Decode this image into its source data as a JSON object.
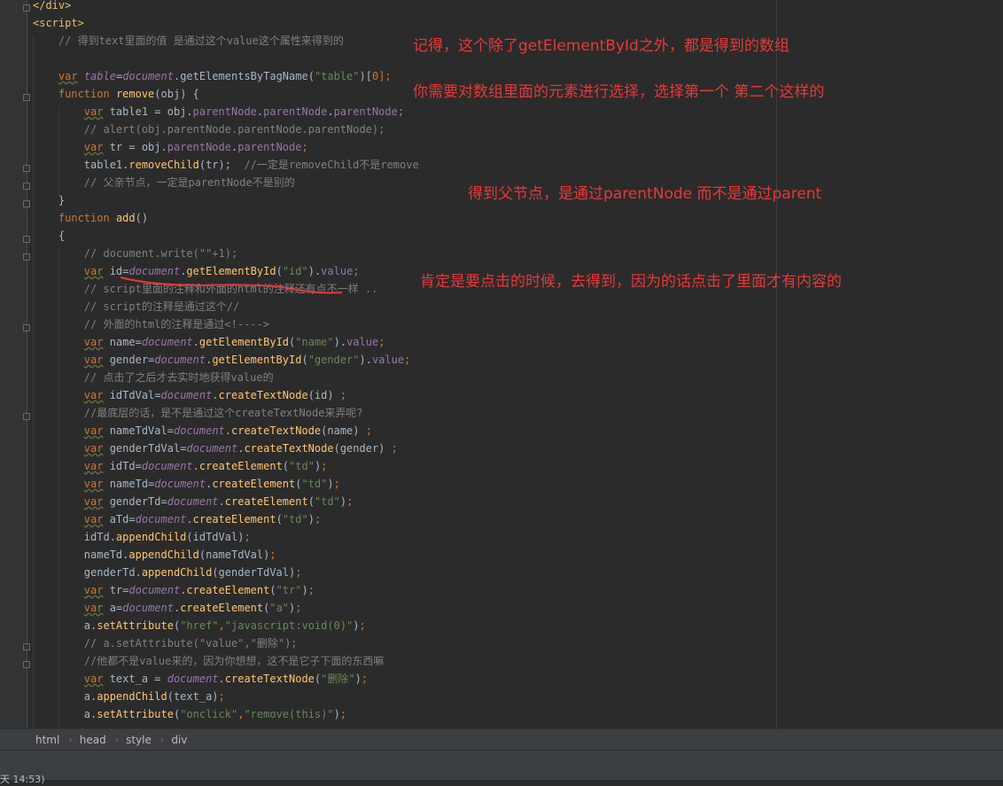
{
  "colors": {
    "background": "#2b2b2b",
    "tag": "#e8bf6a",
    "comment": "#808080",
    "keyword": "#cc7832",
    "string": "#6a8759",
    "method": "#ffc66d",
    "global": "#9876aa",
    "property": "#9876aa",
    "plain": "#a9b7c6",
    "annotation": "#e8383a"
  },
  "code_lines": [
    [
      {
        "t": "</div>",
        "c": "tag"
      }
    ],
    [
      {
        "t": "<script>",
        "c": "tag"
      }
    ],
    [
      {
        "t": "    ",
        "c": "plain"
      },
      {
        "t": "// 得到text里面的值 是通过这个value这个属性来得到的",
        "c": "comment"
      }
    ],
    [
      {
        "t": "",
        "c": "plain"
      }
    ],
    [
      {
        "t": "    ",
        "c": "plain"
      },
      {
        "t": "var",
        "c": "keyword"
      },
      {
        "t": " ",
        "c": "plain"
      },
      {
        "t": "table",
        "c": "global"
      },
      {
        "t": "=",
        "c": "plain"
      },
      {
        "t": "document",
        "c": "global"
      },
      {
        "t": ".getElementsByTagName(",
        "c": "plain"
      },
      {
        "t": "\"table\"",
        "c": "string"
      },
      {
        "t": ")[",
        "c": "plain"
      },
      {
        "t": "0",
        "c": "keyword"
      },
      {
        "t": "];",
        "c": "keyword"
      }
    ],
    [
      {
        "t": "    ",
        "c": "plain"
      },
      {
        "t": "function",
        "c": "keyword"
      },
      {
        "t": " ",
        "c": "plain"
      },
      {
        "t": "remove",
        "c": "method"
      },
      {
        "t": "(obj) {",
        "c": "plain"
      }
    ],
    [
      {
        "t": "        ",
        "c": "plain"
      },
      {
        "t": "var",
        "c": "keyword"
      },
      {
        "t": " table1 = obj.",
        "c": "plain"
      },
      {
        "t": "parentNode",
        "c": "property"
      },
      {
        "t": ".",
        "c": "plain"
      },
      {
        "t": "parentNode",
        "c": "property"
      },
      {
        "t": ".",
        "c": "plain"
      },
      {
        "t": "parentNode",
        "c": "property"
      },
      {
        "t": ";",
        "c": "keyword"
      }
    ],
    [
      {
        "t": "        ",
        "c": "plain"
      },
      {
        "t": "// alert(obj.parentNode.parentNode.parentNode);",
        "c": "comment"
      }
    ],
    [
      {
        "t": "        ",
        "c": "plain"
      },
      {
        "t": "var",
        "c": "keyword"
      },
      {
        "t": " tr = obj.",
        "c": "plain"
      },
      {
        "t": "parentNode",
        "c": "property"
      },
      {
        "t": ".",
        "c": "plain"
      },
      {
        "t": "parentNode",
        "c": "property"
      },
      {
        "t": ";",
        "c": "keyword"
      }
    ],
    [
      {
        "t": "        table1.",
        "c": "plain"
      },
      {
        "t": "removeChild",
        "c": "method"
      },
      {
        "t": "(tr);  ",
        "c": "plain"
      },
      {
        "t": "//一定是removeChild不是remove",
        "c": "comment"
      }
    ],
    [
      {
        "t": "        ",
        "c": "plain"
      },
      {
        "t": "// 父亲节点，一定是parentNode不是别的",
        "c": "comment"
      }
    ],
    [
      {
        "t": "    }",
        "c": "plain"
      }
    ],
    [
      {
        "t": "    ",
        "c": "plain"
      },
      {
        "t": "function",
        "c": "keyword"
      },
      {
        "t": " ",
        "c": "plain"
      },
      {
        "t": "add",
        "c": "method"
      },
      {
        "t": "()",
        "c": "plain"
      }
    ],
    [
      {
        "t": "    {",
        "c": "plain"
      }
    ],
    [
      {
        "t": "        ",
        "c": "plain"
      },
      {
        "t": "// document.write(\"\"+1);",
        "c": "comment"
      }
    ],
    [
      {
        "t": "        ",
        "c": "plain"
      },
      {
        "t": "var",
        "c": "keyword"
      },
      {
        "t": " id=",
        "c": "plain"
      },
      {
        "t": "document",
        "c": "global"
      },
      {
        "t": ".",
        "c": "plain"
      },
      {
        "t": "getElementById",
        "c": "method"
      },
      {
        "t": "(",
        "c": "plain"
      },
      {
        "t": "\"id\"",
        "c": "string"
      },
      {
        "t": ").",
        "c": "plain"
      },
      {
        "t": "value",
        "c": "property"
      },
      {
        "t": ";",
        "c": "keyword"
      }
    ],
    [
      {
        "t": "        ",
        "c": "plain"
      },
      {
        "t": "// script里面的注释和外面的html的注释还有点不一样 ..",
        "c": "comment"
      }
    ],
    [
      {
        "t": "        ",
        "c": "plain"
      },
      {
        "t": "// script的注释是通过这个//",
        "c": "comment"
      }
    ],
    [
      {
        "t": "        ",
        "c": "plain"
      },
      {
        "t": "// 外面的html的注释是通过<!---->",
        "c": "comment"
      }
    ],
    [
      {
        "t": "        ",
        "c": "plain"
      },
      {
        "t": "var",
        "c": "keyword"
      },
      {
        "t": " name=",
        "c": "plain"
      },
      {
        "t": "document",
        "c": "global"
      },
      {
        "t": ".",
        "c": "plain"
      },
      {
        "t": "getElementById",
        "c": "method"
      },
      {
        "t": "(",
        "c": "plain"
      },
      {
        "t": "\"name\"",
        "c": "string"
      },
      {
        "t": ").",
        "c": "plain"
      },
      {
        "t": "value",
        "c": "property"
      },
      {
        "t": ";",
        "c": "keyword"
      }
    ],
    [
      {
        "t": "        ",
        "c": "plain"
      },
      {
        "t": "var",
        "c": "keyword"
      },
      {
        "t": " gender=",
        "c": "plain"
      },
      {
        "t": "document",
        "c": "global"
      },
      {
        "t": ".",
        "c": "plain"
      },
      {
        "t": "getElementById",
        "c": "method"
      },
      {
        "t": "(",
        "c": "plain"
      },
      {
        "t": "\"gender\"",
        "c": "string"
      },
      {
        "t": ").",
        "c": "plain"
      },
      {
        "t": "value",
        "c": "property"
      },
      {
        "t": ";",
        "c": "keyword"
      }
    ],
    [
      {
        "t": "        ",
        "c": "plain"
      },
      {
        "t": "// 点击了之后才去实时地获得value的",
        "c": "comment"
      }
    ],
    [
      {
        "t": "        ",
        "c": "plain"
      },
      {
        "t": "var",
        "c": "keyword"
      },
      {
        "t": " idTdVal=",
        "c": "plain"
      },
      {
        "t": "document",
        "c": "global"
      },
      {
        "t": ".",
        "c": "plain"
      },
      {
        "t": "createTextNode",
        "c": "method"
      },
      {
        "t": "(id) ",
        "c": "plain"
      },
      {
        "t": ";",
        "c": "keyword"
      }
    ],
    [
      {
        "t": "        ",
        "c": "plain"
      },
      {
        "t": "//最底层的话，是不是通过这个createTextNode来弄呢?",
        "c": "comment"
      }
    ],
    [
      {
        "t": "        ",
        "c": "plain"
      },
      {
        "t": "var",
        "c": "keyword"
      },
      {
        "t": " nameTdVal=",
        "c": "plain"
      },
      {
        "t": "document",
        "c": "global"
      },
      {
        "t": ".",
        "c": "plain"
      },
      {
        "t": "createTextNode",
        "c": "method"
      },
      {
        "t": "(name) ",
        "c": "plain"
      },
      {
        "t": ";",
        "c": "keyword"
      }
    ],
    [
      {
        "t": "        ",
        "c": "plain"
      },
      {
        "t": "var",
        "c": "keyword"
      },
      {
        "t": " genderTdVal=",
        "c": "plain"
      },
      {
        "t": "document",
        "c": "global"
      },
      {
        "t": ".",
        "c": "plain"
      },
      {
        "t": "createTextNode",
        "c": "method"
      },
      {
        "t": "(gender) ",
        "c": "plain"
      },
      {
        "t": ";",
        "c": "keyword"
      }
    ],
    [
      {
        "t": "        ",
        "c": "plain"
      },
      {
        "t": "var",
        "c": "keyword"
      },
      {
        "t": " idTd=",
        "c": "plain"
      },
      {
        "t": "document",
        "c": "global"
      },
      {
        "t": ".",
        "c": "plain"
      },
      {
        "t": "createElement",
        "c": "method"
      },
      {
        "t": "(",
        "c": "plain"
      },
      {
        "t": "\"td\"",
        "c": "string"
      },
      {
        "t": ")",
        "c": "plain"
      },
      {
        "t": ";",
        "c": "keyword"
      }
    ],
    [
      {
        "t": "        ",
        "c": "plain"
      },
      {
        "t": "var",
        "c": "keyword"
      },
      {
        "t": " nameTd=",
        "c": "plain"
      },
      {
        "t": "document",
        "c": "global"
      },
      {
        "t": ".",
        "c": "plain"
      },
      {
        "t": "createElement",
        "c": "method"
      },
      {
        "t": "(",
        "c": "plain"
      },
      {
        "t": "\"td\"",
        "c": "string"
      },
      {
        "t": ")",
        "c": "plain"
      },
      {
        "t": ";",
        "c": "keyword"
      }
    ],
    [
      {
        "t": "        ",
        "c": "plain"
      },
      {
        "t": "var",
        "c": "keyword"
      },
      {
        "t": " genderTd=",
        "c": "plain"
      },
      {
        "t": "document",
        "c": "global"
      },
      {
        "t": ".",
        "c": "plain"
      },
      {
        "t": "createElement",
        "c": "method"
      },
      {
        "t": "(",
        "c": "plain"
      },
      {
        "t": "\"td\"",
        "c": "string"
      },
      {
        "t": ")",
        "c": "plain"
      },
      {
        "t": ";",
        "c": "keyword"
      }
    ],
    [
      {
        "t": "        ",
        "c": "plain"
      },
      {
        "t": "var",
        "c": "keyword"
      },
      {
        "t": " aTd=",
        "c": "plain"
      },
      {
        "t": "document",
        "c": "global"
      },
      {
        "t": ".",
        "c": "plain"
      },
      {
        "t": "createElement",
        "c": "method"
      },
      {
        "t": "(",
        "c": "plain"
      },
      {
        "t": "\"td\"",
        "c": "string"
      },
      {
        "t": ")",
        "c": "plain"
      },
      {
        "t": ";",
        "c": "keyword"
      }
    ],
    [
      {
        "t": "        idTd.",
        "c": "plain"
      },
      {
        "t": "appendChild",
        "c": "method"
      },
      {
        "t": "(idTdVal)",
        "c": "plain"
      },
      {
        "t": ";",
        "c": "keyword"
      }
    ],
    [
      {
        "t": "        nameTd.",
        "c": "plain"
      },
      {
        "t": "appendChild",
        "c": "method"
      },
      {
        "t": "(nameTdVal)",
        "c": "plain"
      },
      {
        "t": ";",
        "c": "keyword"
      }
    ],
    [
      {
        "t": "        genderTd.",
        "c": "plain"
      },
      {
        "t": "appendChild",
        "c": "method"
      },
      {
        "t": "(genderTdVal)",
        "c": "plain"
      },
      {
        "t": ";",
        "c": "keyword"
      }
    ],
    [
      {
        "t": "        ",
        "c": "plain"
      },
      {
        "t": "var",
        "c": "keyword"
      },
      {
        "t": " tr=",
        "c": "plain"
      },
      {
        "t": "document",
        "c": "global"
      },
      {
        "t": ".",
        "c": "plain"
      },
      {
        "t": "createElement",
        "c": "method"
      },
      {
        "t": "(",
        "c": "plain"
      },
      {
        "t": "\"tr\"",
        "c": "string"
      },
      {
        "t": ")",
        "c": "plain"
      },
      {
        "t": ";",
        "c": "keyword"
      }
    ],
    [
      {
        "t": "        ",
        "c": "plain"
      },
      {
        "t": "var",
        "c": "keyword"
      },
      {
        "t": " a=",
        "c": "plain"
      },
      {
        "t": "document",
        "c": "global"
      },
      {
        "t": ".",
        "c": "plain"
      },
      {
        "t": "createElement",
        "c": "method"
      },
      {
        "t": "(",
        "c": "plain"
      },
      {
        "t": "\"a\"",
        "c": "string"
      },
      {
        "t": ")",
        "c": "plain"
      },
      {
        "t": ";",
        "c": "keyword"
      }
    ],
    [
      {
        "t": "        a.",
        "c": "plain"
      },
      {
        "t": "setAttribute",
        "c": "method"
      },
      {
        "t": "(",
        "c": "plain"
      },
      {
        "t": "\"href\"",
        "c": "string"
      },
      {
        "t": ",",
        "c": "keyword"
      },
      {
        "t": "\"javascript:void(0)\"",
        "c": "string"
      },
      {
        "t": ")",
        "c": "plain"
      },
      {
        "t": ";",
        "c": "keyword"
      }
    ],
    [
      {
        "t": "        ",
        "c": "plain"
      },
      {
        "t": "// a.setAttribute(\"value\",\"删除\");",
        "c": "comment"
      }
    ],
    [
      {
        "t": "        ",
        "c": "plain"
      },
      {
        "t": "//他都不是value来的，因为你想想，这不是它子下面的东西嘛",
        "c": "comment"
      }
    ],
    [
      {
        "t": "        ",
        "c": "plain"
      },
      {
        "t": "var",
        "c": "keyword"
      },
      {
        "t": " text_a = ",
        "c": "plain"
      },
      {
        "t": "document",
        "c": "global"
      },
      {
        "t": ".",
        "c": "plain"
      },
      {
        "t": "createTextNode",
        "c": "method"
      },
      {
        "t": "(",
        "c": "plain"
      },
      {
        "t": "\"删除\"",
        "c": "string"
      },
      {
        "t": ")",
        "c": "plain"
      },
      {
        "t": ";",
        "c": "keyword"
      }
    ],
    [
      {
        "t": "        a.",
        "c": "plain"
      },
      {
        "t": "appendChild",
        "c": "method"
      },
      {
        "t": "(text_a)",
        "c": "plain"
      },
      {
        "t": ";",
        "c": "keyword"
      }
    ],
    [
      {
        "t": "        a.",
        "c": "plain"
      },
      {
        "t": "setAttribute",
        "c": "method"
      },
      {
        "t": "(",
        "c": "plain"
      },
      {
        "t": "\"onclick\"",
        "c": "string"
      },
      {
        "t": ",",
        "c": "keyword"
      },
      {
        "t": "\"remove(this)\"",
        "c": "string"
      },
      {
        "t": ")",
        "c": "plain"
      },
      {
        "t": ";",
        "c": "keyword"
      }
    ]
  ],
  "annotations": {
    "note1": "记得，这个除了getElementById之外，都是得到的数组",
    "note2": "你需要对数组里面的元素进行选择，选择第一个 第二个这样的",
    "note3": "得到父节点，是通过parentNode  而不是通过parent",
    "note4": "肯定是要点击的时候，去得到，因为的话点击了里面才有内容的"
  },
  "breadcrumb": [
    "html",
    "head",
    "style",
    "div"
  ],
  "statusbar": {
    "text": "天 14:53)"
  }
}
